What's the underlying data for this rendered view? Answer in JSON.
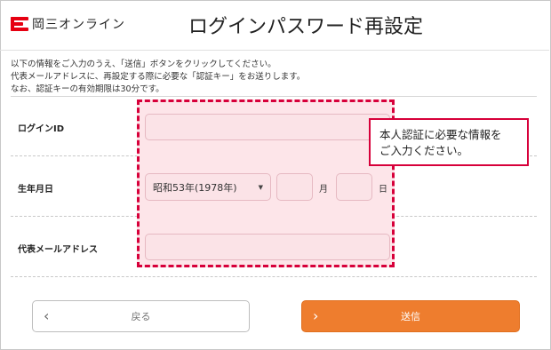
{
  "header": {
    "brand": "岡三オンライン",
    "title": "ログインパスワード再設定"
  },
  "intro": {
    "line1": "以下の情報をご入力のうえ、「送信」ボタンをクリックしてください。",
    "line2": "代表メールアドレスに、再設定する際に必要な「認証キー」をお送りします。",
    "line3": "なお、認証キーの有効期限は30分です。"
  },
  "form": {
    "login_id_label": "ログインID",
    "birth_label": "生年月日",
    "era_year_value": "昭和53年(1978年)",
    "month_unit": "月",
    "day_unit": "日",
    "email_label": "代表メールアドレス"
  },
  "tooltip": {
    "line1": "本人認証に必要な情報を",
    "line2": "ご入力ください。"
  },
  "buttons": {
    "back_label": "戻る",
    "send_label": "送信"
  },
  "colors": {
    "brand_red": "#e60012",
    "highlight_border": "#d7003a",
    "send_orange": "#ee7d2e"
  }
}
